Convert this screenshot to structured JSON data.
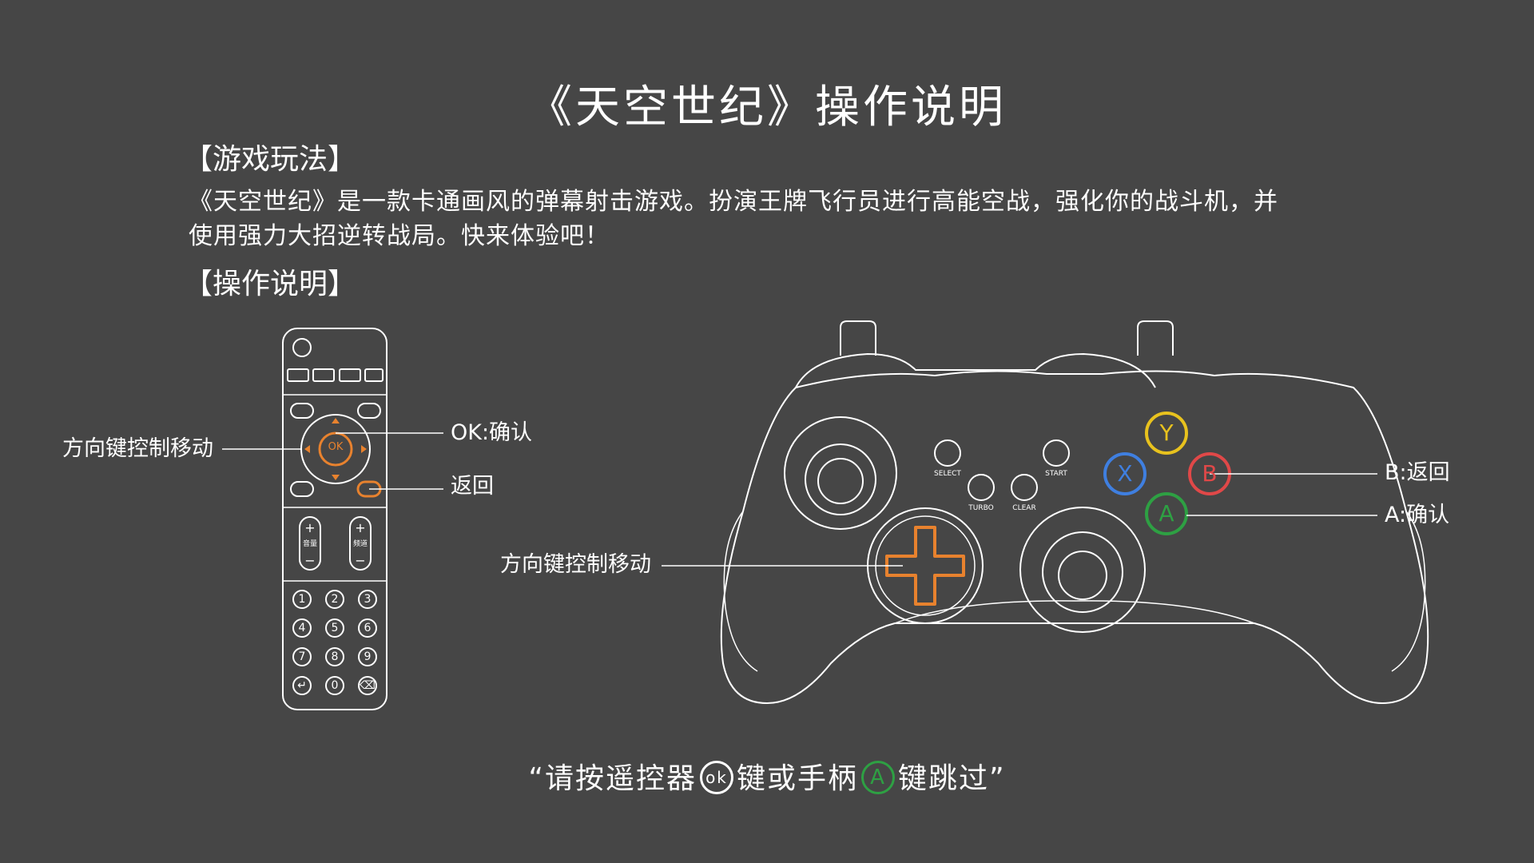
{
  "title": "《天空世纪》操作说明",
  "gameplay": {
    "heading": "【游戏玩法】",
    "description": "《天空世纪》是一款卡通画风的弹幕射击游戏。扮演王牌飞行员进行高能空战，强化你的战斗机，并使用强力大招逆转战局。快来体验吧！"
  },
  "controls": {
    "heading": "【操作说明】",
    "remote": {
      "dpad_label": "方向键控制移动",
      "ok_label": "OK:确认",
      "back_label": "返回",
      "ok_text": "OK",
      "volume_text": "音量",
      "channel_text": "频道",
      "plus": "+",
      "minus": "−",
      "keys": [
        "1",
        "2",
        "3",
        "4",
        "5",
        "6",
        "7",
        "8",
        "9",
        "↵",
        "0",
        "⌫"
      ]
    },
    "gamepad": {
      "dpad_label": "方向键控制移动",
      "b_label": "B:返回",
      "a_label": "A:确认",
      "buttons": {
        "y": "Y",
        "x": "X",
        "b": "B",
        "a": "A"
      },
      "small_buttons": {
        "select": "SELECT",
        "start": "START",
        "turbo": "TURBO",
        "clear": "CLEAR"
      }
    }
  },
  "footer": {
    "part1": "“请按遥控器",
    "ok_badge": "ok",
    "part2": "键或手柄",
    "a_badge": "A",
    "part3": "键跳过”"
  },
  "colors": {
    "background": "#464646",
    "accent_orange": "#e8822e",
    "y_yellow": "#e8c21e",
    "x_blue": "#3f7fe0",
    "b_red": "#e04848",
    "a_green": "#2ea043"
  }
}
